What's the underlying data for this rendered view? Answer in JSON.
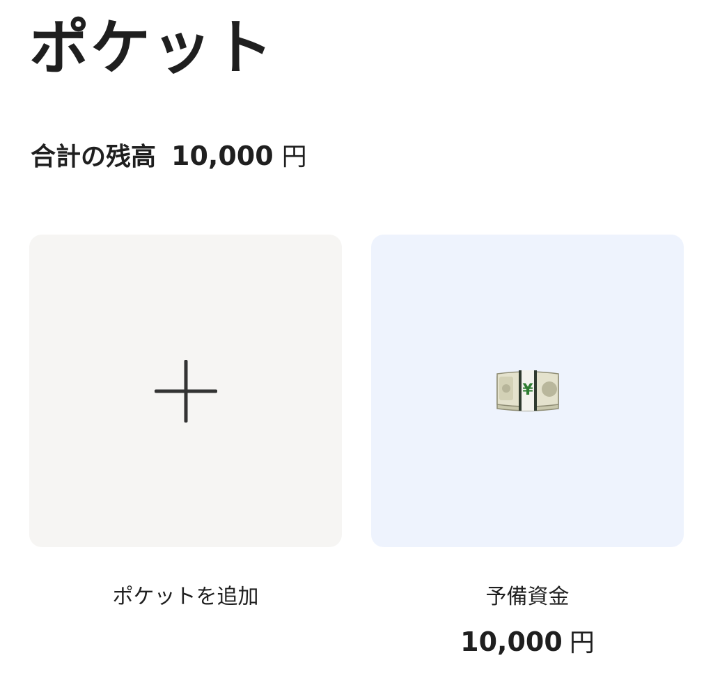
{
  "header": {
    "title": "ポケット"
  },
  "summary": {
    "label": "合計の残高",
    "amount": "10,000",
    "unit": "円"
  },
  "pockets": [
    {
      "label": "ポケットを追加",
      "icon": "plus-icon",
      "background": "#f6f5f3"
    },
    {
      "label": "予備資金",
      "icon": "yen-banknote-icon",
      "background": "#eef3fd",
      "amount": "10,000",
      "unit": "円"
    }
  ]
}
